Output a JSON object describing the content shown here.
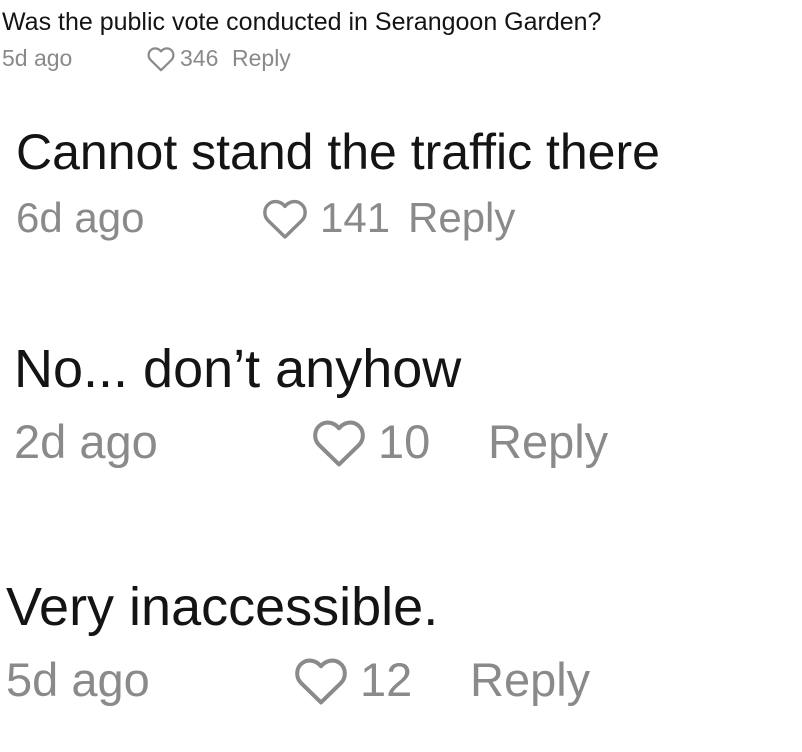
{
  "comments": [
    {
      "text": "Was the public vote conducted in Serangoon Garden?",
      "time": "5d ago",
      "likes": "346",
      "reply_label": "Reply"
    },
    {
      "text": "Cannot stand the traffic there",
      "time": "6d ago",
      "likes": "141",
      "reply_label": "Reply"
    },
    {
      "text": "No... don’t anyhow",
      "time": "2d ago",
      "likes": "10",
      "reply_label": "Reply"
    },
    {
      "text": "Very inaccessible.",
      "time": "5d ago",
      "likes": "12",
      "reply_label": "Reply"
    }
  ],
  "icons": {
    "like": "heart-outline-icon"
  },
  "colors": {
    "text": "#141414",
    "meta": "#8a8a8a",
    "background": "#ffffff"
  }
}
